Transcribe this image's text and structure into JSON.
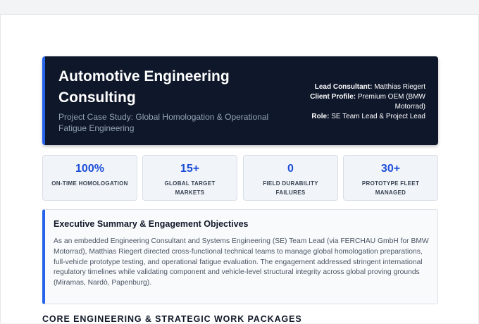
{
  "hero": {
    "title": "Automotive Engineering Consulting",
    "subtitle": "Project Case Study: Global Homologation & Operational Fatigue Engineering",
    "meta": [
      {
        "label": "Lead Consultant:",
        "value": "Matthias Riegert"
      },
      {
        "label": "Client Profile:",
        "value": "Premium OEM (BMW Motorrad)"
      },
      {
        "label": "Role:",
        "value": "SE Team Lead & Project Lead"
      }
    ]
  },
  "stats": [
    {
      "value": "100%",
      "label": "On-Time Homologation"
    },
    {
      "value": "15+",
      "label": "Global Target Markets"
    },
    {
      "value": "0",
      "label": "Field Durability Failures"
    },
    {
      "value": "30+",
      "label": "Prototype Fleet Managed"
    }
  ],
  "summary": {
    "title": "Executive Summary & Engagement Objectives",
    "body": "As an embedded Engineering Consultant and Systems Engineering (SE) Team Lead (via FERCHAU GmbH for BMW Motorrad), Matthias Riegert directed cross-functional technical teams to manage global homologation preparations, full-vehicle prototype testing, and operational fatigue evaluation. The engagement addressed stringent international regulatory timelines while validating component and vehicle-level structural integrity across global proving grounds (Miramas, Nardò, Papenburg)."
  },
  "section_heading": "Core Engineering & Strategic Work Packages",
  "colors": {
    "accent": "#2563eb",
    "hero_bg": "#0f172a",
    "stat_value": "#1d4ed8"
  }
}
